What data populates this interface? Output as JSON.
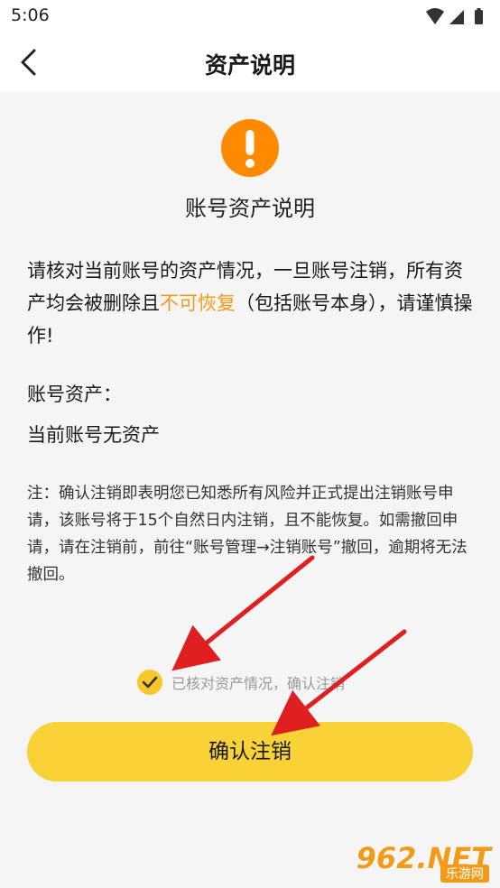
{
  "status_bar": {
    "time": "5:06"
  },
  "nav": {
    "title": "资产说明"
  },
  "content": {
    "heading": "账号资产说明",
    "warning_part1": "请核对当前账号的资产情况，一旦账号注销，所有资产均会被删除且",
    "warning_highlight": "不可恢复",
    "warning_part2": "（包括账号本身），请谨慎操作!",
    "assets_label": "账号资产：",
    "assets_value": "当前账号无资产",
    "note": "注：确认注销即表明您已知悉所有风险并正式提出注销账号申请，该账号将于15个自然日内注销，且不能恢复。如需撤回申请，请在注销前，前往“账号管理→注销账号”撤回，逾期将无法撤回。"
  },
  "confirm": {
    "checkbox_label": "已核对资产情况，确认注销",
    "checked": true,
    "button_label": "确认注销"
  },
  "colors": {
    "accent_orange": "#ff8a00",
    "highlight_text": "#f39a19",
    "button_yellow": "#f8d236",
    "check_yellow": "#f8c72a",
    "arrow_red": "#e02020"
  },
  "watermark": {
    "main": "962.NET",
    "sub": "乐游网"
  }
}
